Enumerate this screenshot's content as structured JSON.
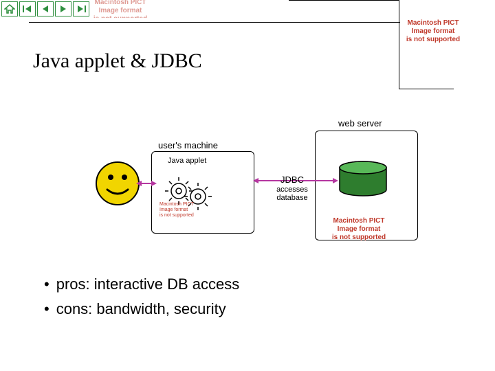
{
  "toolbar": {
    "home": "home-icon",
    "first": "first-icon",
    "prev": "prev-icon",
    "next": "next-icon",
    "last": "last-icon"
  },
  "unsupported_msg": "Macintosh PICT\nImage format\nis not supported",
  "title": "Java applet & JDBC",
  "diagram": {
    "user_machine_label": "user's machine",
    "web_server_label": "web server",
    "java_applet_label": "Java applet",
    "jdbc_label": "JDBC",
    "accesses_label": "accesses",
    "database_label": "database"
  },
  "bullets": {
    "pros": "pros:  interactive DB access",
    "cons": "cons:  bandwidth, security"
  },
  "colors": {
    "toolbar_green": "#2f8f3f",
    "smiley_yellow": "#f1d500",
    "db_green": "#3aa03a",
    "error_red": "#c0392b",
    "arrow_magenta": "#b536a0"
  }
}
